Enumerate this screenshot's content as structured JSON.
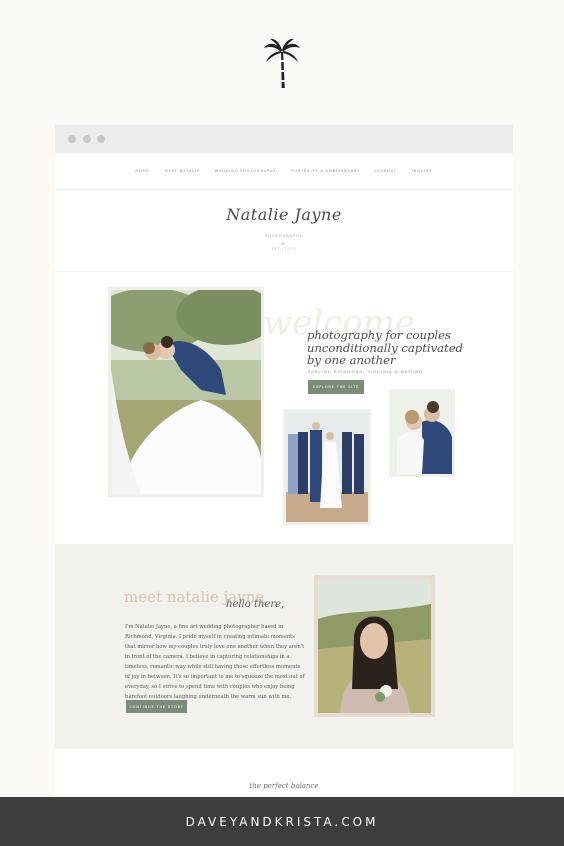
{
  "logo": {
    "icon": "palm-tree-icon"
  },
  "browser": {
    "nav": [
      "Home",
      "Meet Natalie",
      "Wedding Photography",
      "Portraits & Anniversary",
      "Journal",
      "Inquire"
    ]
  },
  "brand": {
    "name": "Natalie Jayne",
    "sub": "PHOTOGRAPHY",
    "est": "EST. 2015"
  },
  "hero": {
    "welcome": "welcome",
    "tagline": "photography for couples unconditionally captivated by one another",
    "serving": "SERVING RICHMOND, VIRGINIA & BEYOND",
    "button": "EXPLORE THE SITE"
  },
  "about": {
    "heading": "meet natalie jayne",
    "script": "hello there,",
    "paragraph": "I'm Natalie Jayne, a fine art wedding photographer based in Richmond, Virginia. I pride myself in creating intimate moments that mirror how my couples truly love one another when they aren't in front of the camera. I believe in capturing relationships in a timeless, romantic way while still having those effortless moments of joy in between. It's so important to me to squeeze the most out of everyday, so I strive to spend time with couples who enjoy being barefoot outdoors laughing underneath the warm sun with me.",
    "button": "CONTINUE THE STORY"
  },
  "section": {
    "perfect": "the perfect balance"
  },
  "footer": {
    "text": "DAVEYANDKRISTA.COM"
  },
  "colors": {
    "accent": "#7d8b7a",
    "blush": "#d8c4ae",
    "footer": "#3d3d3d"
  }
}
